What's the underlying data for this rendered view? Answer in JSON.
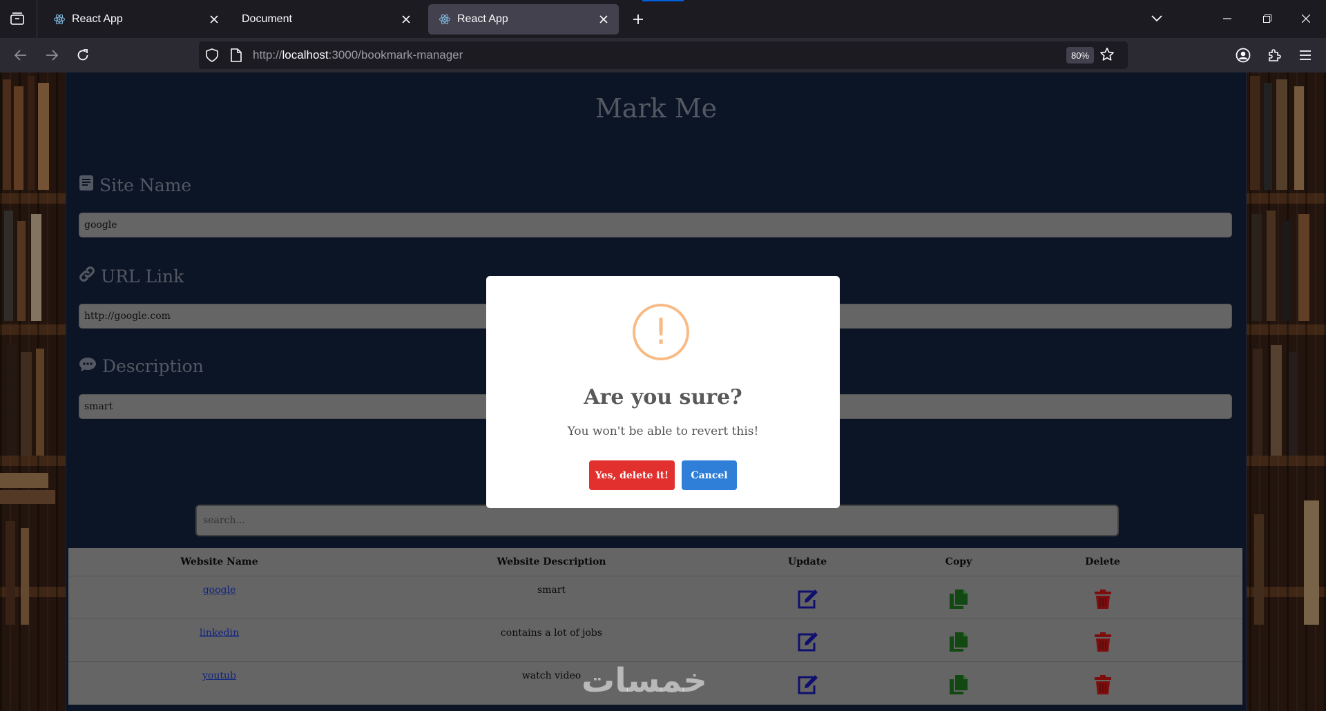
{
  "browser": {
    "tabs": [
      {
        "label": "React App",
        "active": false
      },
      {
        "label": "Document",
        "active": false
      },
      {
        "label": "React App",
        "active": true
      }
    ],
    "url_prefix": "http://",
    "url_host": "localhost",
    "url_rest": ":3000/bookmark-manager",
    "zoom": "80%"
  },
  "app": {
    "title": "Mark Me",
    "fields": [
      {
        "label": "Site Name",
        "value": "google",
        "icon": "book-icon"
      },
      {
        "label": "URL Link",
        "value": "http://google.com",
        "icon": "link-icon"
      },
      {
        "label": "Description",
        "value": "smart",
        "icon": "comment-icon"
      }
    ],
    "search_placeholder": "search...",
    "table": {
      "headers": [
        "Website Name",
        "Website Description",
        "Update",
        "Copy",
        "Delete"
      ],
      "rows": [
        {
          "name": "google",
          "description": "smart"
        },
        {
          "name": "linkedin",
          "description": "contains a lot of jobs"
        },
        {
          "name": "youtub",
          "description": "watch video"
        }
      ]
    }
  },
  "dialog": {
    "icon_glyph": "!",
    "title": "Are you sure?",
    "text": "You won't be able to revert this!",
    "confirm_label": "Yes, delete it!",
    "cancel_label": "Cancel"
  },
  "watermark": "خمسات",
  "colors": {
    "app_bg": "#15233f",
    "confirm": "#e2302e",
    "cancel": "#2f7fd8",
    "warning": "#f8bb86",
    "update_icon": "#1a1ab8",
    "copy_icon": "#1f7a1f",
    "delete_icon": "#d01818"
  }
}
